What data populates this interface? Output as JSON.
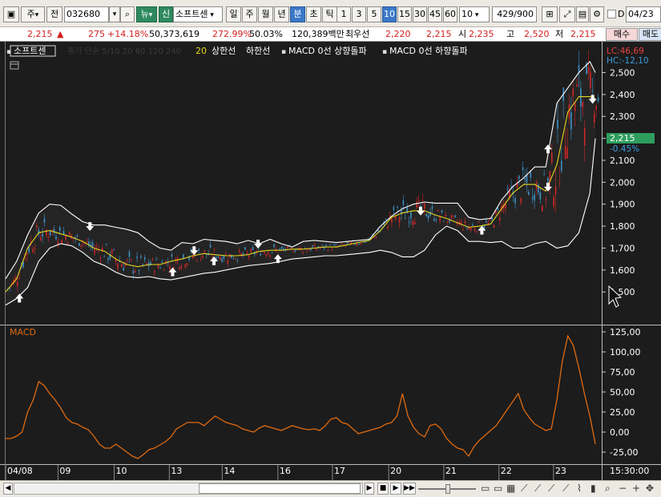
{
  "toolbar": {
    "type_select": "주",
    "prev_label": "전",
    "code": "032680",
    "news_label": "뉴",
    "new_badge": "신",
    "stock_name": "소프트센",
    "periods": [
      "일",
      "주",
      "월",
      "년",
      "분",
      "초",
      "틱"
    ],
    "active_period": "분",
    "intervals": [
      "1",
      "3",
      "5",
      "10",
      "15",
      "30",
      "45",
      "60"
    ],
    "active_interval": "10",
    "interval_select": "10",
    "count_value": "429",
    "count_total": "/900",
    "date_value": "04/23"
  },
  "quote": {
    "price": "2,215",
    "change": "275",
    "change_pct": "+14.18%",
    "volume": "50,373,619",
    "volume_ratio": "272.99%",
    "turnover": "50.03%",
    "amount": "120,389백만",
    "priority_label": "최우선",
    "ask": "2,220",
    "bid": "2,215",
    "open_label": "시",
    "open": "2,235",
    "high_label": "고",
    "high": "2,520",
    "low_label": "저",
    "low": "2,215",
    "buy_label": "매수",
    "sell_label": "매도"
  },
  "legend": {
    "name": "소프트센",
    "ma_text": "종가 단순 5/10 20 60 120 240",
    "bb_period": "20",
    "upper_label": "상한선",
    "lower_label": "하한선",
    "macd_up": "MACD 0선 상향돌파",
    "macd_down": "MACD 0선 하향돌파"
  },
  "axis_top_labels": {
    "lc": "LC:46,69",
    "hc": "HC:-12,10"
  },
  "price_tag": {
    "price": "2,215",
    "change": "-0.45%",
    "color": "#2e9e5e"
  },
  "macd_title": "MACD",
  "time_end": "15:30:00",
  "colors": {
    "up": "#e02020",
    "down": "#3a9ad9",
    "band": "#ffffff",
    "mid": "#e8d820",
    "macd": "#e06a10"
  },
  "chart_data": [
    {
      "type": "line",
      "pane": "price",
      "y_ticks": [
        2500,
        2400,
        2300,
        2200,
        2100,
        2000,
        1900,
        1800,
        1700,
        1600,
        1500
      ],
      "y_tick_labels": [
        "2,500",
        "2,400",
        "2,300",
        "2,200",
        "2,100",
        "2,000",
        "1,900",
        "1,800",
        "1,700",
        "1,600",
        "1,500"
      ],
      "x_labels": [
        "04/08",
        "09",
        "10",
        "13",
        "14",
        "16",
        "17",
        "20",
        "21",
        "22",
        "23"
      ],
      "x_label_pos": [
        0,
        9.5,
        19.7,
        29.7,
        39.3,
        49.4,
        59.3,
        69.5,
        79.5,
        89.5,
        99.4
      ],
      "x_span": [
        0,
        108
      ],
      "ylim": [
        1430,
        2560
      ],
      "series": [
        {
          "name": "상한선",
          "x": [
            0,
            2,
            4,
            6,
            8,
            10,
            12,
            14,
            16,
            18,
            20,
            22,
            24,
            26,
            28,
            30,
            32,
            34,
            36,
            38,
            40,
            42,
            44,
            46,
            48,
            50,
            52,
            54,
            56,
            58,
            60,
            62,
            64,
            66,
            68,
            70,
            72,
            74,
            76,
            78,
            80,
            82,
            84,
            86,
            88,
            90,
            92,
            94,
            96,
            98,
            100,
            102,
            104,
            106,
            107
          ],
          "values": [
            1560,
            1640,
            1760,
            1860,
            1900,
            1895,
            1855,
            1820,
            1805,
            1805,
            1795,
            1785,
            1770,
            1730,
            1700,
            1690,
            1725,
            1720,
            1740,
            1735,
            1730,
            1720,
            1735,
            1720,
            1740,
            1720,
            1705,
            1730,
            1735,
            1730,
            1725,
            1730,
            1735,
            1740,
            1800,
            1845,
            1880,
            1900,
            1910,
            1905,
            1905,
            1905,
            1840,
            1830,
            1835,
            1920,
            1980,
            2020,
            2070,
            2070,
            2360,
            2430,
            2500,
            2550,
            2500
          ]
        },
        {
          "name": "하한선",
          "x": [
            0,
            2,
            4,
            6,
            8,
            10,
            12,
            14,
            16,
            18,
            20,
            22,
            24,
            26,
            28,
            30,
            32,
            34,
            36,
            38,
            40,
            42,
            44,
            46,
            48,
            50,
            52,
            54,
            56,
            58,
            60,
            62,
            64,
            66,
            68,
            70,
            72,
            74,
            76,
            78,
            80,
            82,
            84,
            86,
            88,
            90,
            92,
            94,
            96,
            98,
            100,
            102,
            104,
            106,
            107
          ],
          "values": [
            1440,
            1470,
            1520,
            1640,
            1700,
            1720,
            1710,
            1680,
            1640,
            1620,
            1590,
            1570,
            1565,
            1570,
            1560,
            1555,
            1565,
            1575,
            1585,
            1590,
            1600,
            1610,
            1620,
            1625,
            1630,
            1640,
            1650,
            1655,
            1660,
            1665,
            1665,
            1670,
            1675,
            1680,
            1690,
            1680,
            1660,
            1660,
            1690,
            1760,
            1800,
            1780,
            1730,
            1730,
            1725,
            1730,
            1700,
            1700,
            1720,
            1730,
            1700,
            1710,
            1770,
            1950,
            2200
          ]
        },
        {
          "name": "20",
          "x": [
            0,
            2,
            4,
            6,
            8,
            10,
            12,
            14,
            16,
            18,
            20,
            22,
            24,
            26,
            28,
            30,
            32,
            34,
            36,
            38,
            40,
            42,
            44,
            46,
            48,
            50,
            52,
            54,
            56,
            58,
            60,
            62,
            64,
            66,
            68,
            70,
            72,
            74,
            76,
            78,
            80,
            82,
            84,
            86,
            88,
            90,
            92,
            94,
            96,
            98,
            100,
            102,
            104,
            106,
            107
          ],
          "values": [
            1500,
            1560,
            1700,
            1770,
            1780,
            1765,
            1750,
            1730,
            1700,
            1685,
            1650,
            1625,
            1615,
            1625,
            1625,
            1640,
            1650,
            1665,
            1675,
            1670,
            1665,
            1665,
            1670,
            1685,
            1690,
            1690,
            1695,
            1695,
            1700,
            1705,
            1705,
            1715,
            1725,
            1735,
            1780,
            1840,
            1860,
            1870,
            1870,
            1850,
            1835,
            1815,
            1795,
            1800,
            1810,
            1880,
            1950,
            1990,
            1990,
            1960,
            2080,
            2320,
            2390,
            2390,
            2380
          ]
        }
      ],
      "signals": [
        {
          "x": 2.5,
          "dir": "up",
          "y": 1470
        },
        {
          "x": 15.3,
          "dir": "down",
          "y": 1800
        },
        {
          "x": 30.3,
          "dir": "up",
          "y": 1590
        },
        {
          "x": 34.2,
          "dir": "down",
          "y": 1690
        },
        {
          "x": 37.8,
          "dir": "up",
          "y": 1640
        },
        {
          "x": 45.8,
          "dir": "down",
          "y": 1720
        },
        {
          "x": 49.4,
          "dir": "up",
          "y": 1650
        },
        {
          "x": 75.3,
          "dir": "down",
          "y": 1870
        },
        {
          "x": 86.4,
          "dir": "up",
          "y": 1780
        },
        {
          "x": 98.4,
          "dir": "down",
          "y": 1980
        },
        {
          "x": 98.4,
          "dir": "up",
          "y": 2150
        },
        {
          "x": 106.5,
          "dir": "down",
          "y": 2380
        }
      ]
    },
    {
      "type": "line",
      "pane": "macd",
      "name": "MACD",
      "y_ticks": [
        125,
        100,
        75,
        50,
        25,
        0,
        -25
      ],
      "y_tick_labels": [
        "125,00",
        "100,00",
        "75,00",
        "50,00",
        "25,00",
        "0,00",
        "-25,00"
      ],
      "ylim": [
        -35,
        135
      ],
      "x": [
        0,
        1,
        2,
        3,
        4,
        5,
        6,
        7,
        8,
        9,
        10,
        11,
        12,
        13,
        14,
        15,
        16,
        17,
        18,
        19,
        20,
        21,
        22,
        23,
        24,
        25,
        26,
        27,
        28,
        29,
        30,
        31,
        32,
        33,
        34,
        35,
        36,
        37,
        38,
        39,
        40,
        41,
        42,
        43,
        44,
        45,
        46,
        47,
        48,
        49,
        50,
        51,
        52,
        53,
        54,
        55,
        56,
        57,
        58,
        59,
        60,
        61,
        62,
        63,
        64,
        65,
        66,
        67,
        68,
        69,
        70,
        71,
        72,
        73,
        74,
        75,
        76,
        77,
        78,
        79,
        80,
        81,
        82,
        83,
        84,
        85,
        86,
        87,
        88,
        89,
        90,
        91,
        92,
        93,
        94,
        95,
        96,
        97,
        98,
        99,
        100,
        101,
        102,
        103,
        104,
        105,
        106,
        107
      ],
      "values": [
        -8,
        -8,
        -5,
        0,
        25,
        40,
        63,
        58,
        48,
        40,
        30,
        18,
        12,
        10,
        6,
        3,
        -5,
        -15,
        -20,
        -20,
        -15,
        -20,
        -25,
        -30,
        -33,
        -28,
        -22,
        -20,
        -16,
        -12,
        -6,
        4,
        8,
        12,
        12,
        12,
        8,
        14,
        20,
        16,
        12,
        10,
        8,
        4,
        2,
        0,
        5,
        8,
        6,
        4,
        2,
        5,
        8,
        6,
        4,
        3,
        4,
        2,
        8,
        16,
        18,
        12,
        10,
        4,
        -2,
        0,
        2,
        4,
        6,
        10,
        12,
        20,
        48,
        20,
        6,
        -2,
        -6,
        8,
        10,
        4,
        -8,
        -15,
        -20,
        -22,
        -30,
        -18,
        -10,
        -4,
        2,
        8,
        18,
        28,
        38,
        48,
        28,
        18,
        10,
        6,
        2,
        4,
        40,
        88,
        120,
        108,
        80,
        48,
        20,
        -15
      ]
    }
  ]
}
